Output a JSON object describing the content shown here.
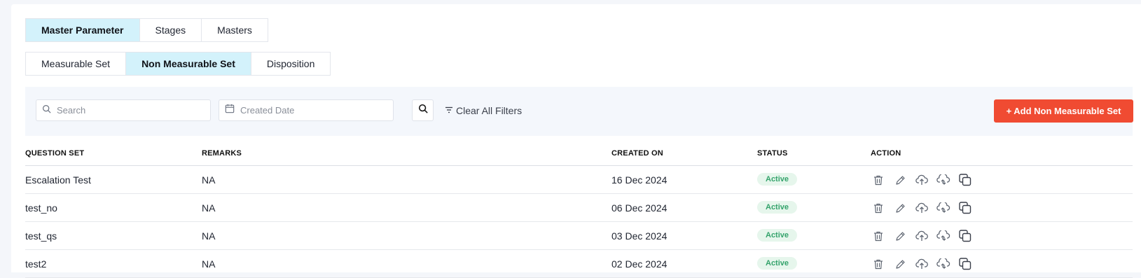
{
  "top_tabs": [
    {
      "label": "Master Parameter",
      "active": true
    },
    {
      "label": "Stages",
      "active": false
    },
    {
      "label": "Masters",
      "active": false
    }
  ],
  "sub_tabs": [
    {
      "label": "Measurable Set",
      "active": false
    },
    {
      "label": "Non Measurable Set",
      "active": true
    },
    {
      "label": "Disposition",
      "active": false
    }
  ],
  "filters": {
    "search_placeholder": "Search",
    "date_placeholder": "Created Date",
    "clear_label": "Clear All Filters",
    "add_label": "+ Add Non Measurable Set"
  },
  "table": {
    "headers": [
      "QUESTION SET",
      "REMARKS",
      "CREATED ON",
      "STATUS",
      "ACTION"
    ],
    "rows": [
      {
        "question_set": "Escalation Test",
        "remarks": "NA",
        "created_on": "16 Dec 2024",
        "status": "Active"
      },
      {
        "question_set": "test_no",
        "remarks": "NA",
        "created_on": "06 Dec 2024",
        "status": "Active"
      },
      {
        "question_set": "test_qs",
        "remarks": "NA",
        "created_on": "03 Dec 2024",
        "status": "Active"
      },
      {
        "question_set": "test2",
        "remarks": "NA",
        "created_on": "02 Dec 2024",
        "status": "Active"
      }
    ],
    "action_icons": [
      "trash-icon",
      "pencil-icon",
      "cloud-upload-icon",
      "cloud-sync-icon",
      "copy-icon"
    ]
  },
  "colors": {
    "accent_tab": "#d3f2fb",
    "add_button": "#f04b32",
    "status_active_bg": "#e6f6ec",
    "status_active_text": "#34a36b"
  }
}
